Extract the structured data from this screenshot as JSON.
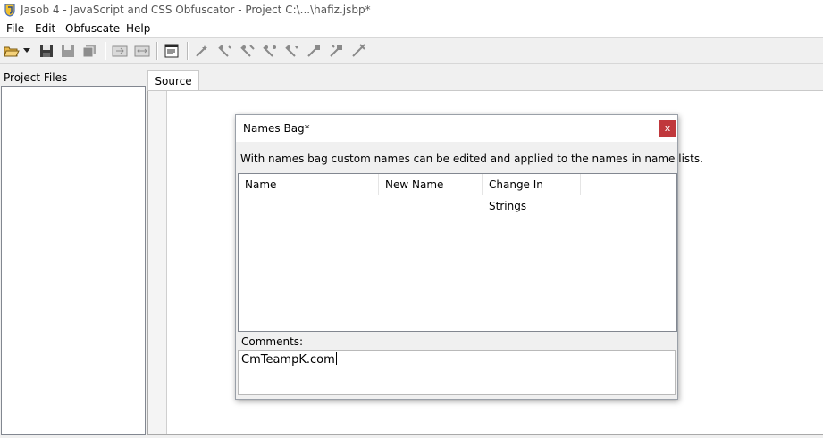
{
  "window": {
    "title": "Jasob 4 - JavaScript and CSS Obfuscator - Project  C:\\...\\hafiz.jsbp*"
  },
  "menu": {
    "items": [
      {
        "label": "File"
      },
      {
        "label": "Edit"
      },
      {
        "label": "Obfuscate"
      },
      {
        "label": "Help"
      }
    ]
  },
  "toolbar": {
    "icons": [
      "open-folder-icon",
      "dropdown-arrow-icon",
      "save-icon",
      "save-as-icon",
      "save-all-icon",
      "import-icon",
      "export-icon",
      "properties-icon",
      "wand-1-icon",
      "wand-2-icon",
      "wand-3-icon",
      "wand-4-icon",
      "wand-5-icon",
      "wand-6-icon",
      "wand-7-icon",
      "wand-8-icon"
    ]
  },
  "project_files": {
    "label": "Project Files"
  },
  "editor": {
    "tabs": [
      {
        "label": "Source"
      }
    ]
  },
  "dialog": {
    "title": "Names Bag*",
    "close_label": "x",
    "description": "With names bag custom names can be edited and applied to the names in name lists.",
    "columns": [
      {
        "label": "Name"
      },
      {
        "label": "New Name"
      },
      {
        "label": "Change In Strings"
      }
    ],
    "comments_label": "Comments:",
    "comments_value": "CmTeampK.com",
    "close_color": "#c0383c"
  }
}
